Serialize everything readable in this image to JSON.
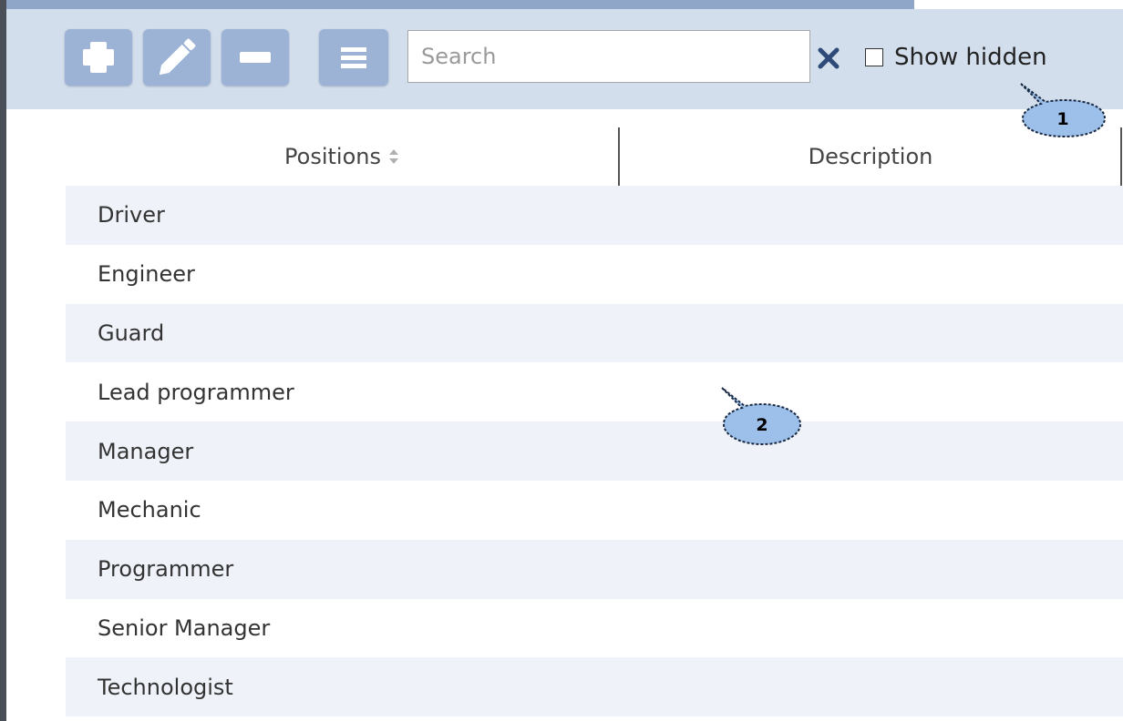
{
  "toolbar": {
    "buttons": [
      {
        "name": "add",
        "icon": "plus-icon"
      },
      {
        "name": "edit",
        "icon": "pencil-icon"
      },
      {
        "name": "remove",
        "icon": "minus-icon"
      },
      {
        "name": "menu",
        "icon": "menu-icon"
      }
    ],
    "search": {
      "placeholder": "Search",
      "value": ""
    },
    "clear_icon": "close-icon",
    "show_hidden": {
      "label": "Show hidden",
      "checked": false
    }
  },
  "table": {
    "columns": [
      {
        "label": "Positions",
        "sortable": true
      },
      {
        "label": "Description",
        "sortable": false
      }
    ],
    "rows": [
      {
        "position": "Driver",
        "description": ""
      },
      {
        "position": "Engineer",
        "description": ""
      },
      {
        "position": "Guard",
        "description": ""
      },
      {
        "position": "Lead programmer",
        "description": ""
      },
      {
        "position": "Manager",
        "description": ""
      },
      {
        "position": "Mechanic",
        "description": ""
      },
      {
        "position": "Programmer",
        "description": ""
      },
      {
        "position": "Senior Manager",
        "description": ""
      },
      {
        "position": "Technologist",
        "description": ""
      }
    ]
  },
  "callouts": [
    {
      "number": "1"
    },
    {
      "number": "2"
    }
  ],
  "colors": {
    "toolbar_bg": "#d3deec",
    "button_bg": "#9db3d6",
    "row_alt_bg": "#eff3f9",
    "accent": "#2e4a78"
  }
}
